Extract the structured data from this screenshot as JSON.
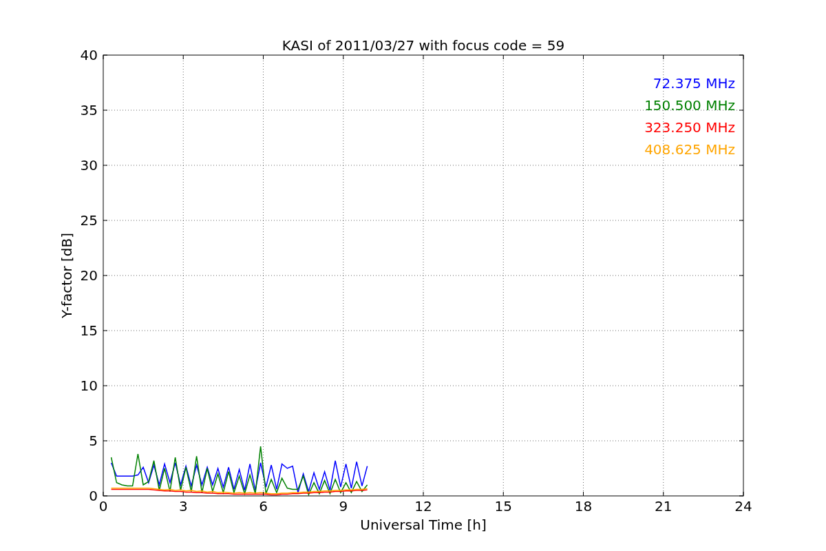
{
  "chart_data": {
    "type": "line",
    "title": "KASI of 2011/03/27 with focus code = 59",
    "xlabel": "Universal Time [h]",
    "ylabel": "Y-factor [dB]",
    "x": [
      0.3,
      0.5,
      0.7,
      0.9,
      1.1,
      1.3,
      1.5,
      1.7,
      1.9,
      2.1,
      2.3,
      2.5,
      2.7,
      2.9,
      3.1,
      3.3,
      3.5,
      3.7,
      3.9,
      4.1,
      4.3,
      4.5,
      4.7,
      4.9,
      5.1,
      5.3,
      5.5,
      5.7,
      5.9,
      6.1,
      6.3,
      6.5,
      6.7,
      6.9,
      7.1,
      7.3,
      7.5,
      7.7,
      7.9,
      8.1,
      8.3,
      8.5,
      8.7,
      8.9,
      9.1,
      9.3,
      9.5,
      9.7,
      9.9
    ],
    "series": [
      {
        "name": "72.375 MHz",
        "color": "#0000ff",
        "values": [
          3.0,
          1.8,
          1.8,
          1.8,
          1.8,
          1.9,
          2.6,
          1.2,
          2.8,
          1.0,
          2.9,
          1.2,
          3.0,
          1.0,
          2.7,
          0.9,
          2.8,
          1.0,
          2.6,
          1.0,
          2.5,
          0.8,
          2.6,
          0.6,
          2.4,
          0.5,
          2.9,
          0.5,
          3.0,
          0.8,
          2.8,
          0.6,
          2.9,
          2.5,
          2.7,
          0.3,
          2.0,
          0.4,
          2.1,
          0.6,
          2.2,
          0.5,
          3.2,
          0.8,
          2.9,
          0.7,
          3.1,
          0.9,
          2.7
        ]
      },
      {
        "name": "150.500 MHz",
        "color": "#008000",
        "values": [
          3.5,
          1.2,
          1.0,
          0.9,
          0.9,
          3.8,
          1.0,
          1.3,
          3.2,
          0.5,
          2.5,
          0.4,
          3.5,
          0.5,
          2.6,
          0.4,
          3.6,
          0.3,
          2.5,
          0.4,
          2.0,
          0.3,
          2.2,
          0.3,
          1.8,
          0.2,
          1.9,
          0.2,
          4.5,
          0.2,
          1.5,
          0.3,
          1.6,
          0.7,
          0.6,
          0.6,
          1.8,
          0.1,
          1.2,
          0.2,
          1.4,
          0.2,
          1.5,
          0.3,
          1.2,
          0.3,
          1.3,
          0.4,
          1.0
        ]
      },
      {
        "name": "323.250 MHz",
        "color": "#ff0000",
        "values": [
          0.6,
          0.6,
          0.6,
          0.6,
          0.6,
          0.6,
          0.6,
          0.6,
          0.55,
          0.5,
          0.45,
          0.45,
          0.4,
          0.4,
          0.35,
          0.35,
          0.3,
          0.3,
          0.25,
          0.25,
          0.2,
          0.2,
          0.2,
          0.15,
          0.15,
          0.15,
          0.15,
          0.15,
          0.15,
          0.15,
          0.1,
          0.1,
          0.15,
          0.15,
          0.2,
          0.2,
          0.25,
          0.25,
          0.3,
          0.3,
          0.35,
          0.35,
          0.4,
          0.4,
          0.45,
          0.45,
          0.5,
          0.5,
          0.55
        ]
      },
      {
        "name": "408.625 MHz",
        "color": "#ffa500",
        "values": [
          0.7,
          0.7,
          0.7,
          0.7,
          0.7,
          0.7,
          0.7,
          0.7,
          0.65,
          0.6,
          0.55,
          0.6,
          0.5,
          0.55,
          0.45,
          0.5,
          0.4,
          0.45,
          0.35,
          0.4,
          0.3,
          0.35,
          0.3,
          0.25,
          0.3,
          0.25,
          0.3,
          0.25,
          0.3,
          0.25,
          0.2,
          0.2,
          0.25,
          0.25,
          0.3,
          0.3,
          0.35,
          0.35,
          0.4,
          0.4,
          0.45,
          0.45,
          0.5,
          0.5,
          0.55,
          0.55,
          0.6,
          0.6,
          0.65
        ]
      }
    ],
    "xlim": [
      0,
      24
    ],
    "ylim": [
      0,
      40
    ],
    "xticks": [
      0,
      3,
      6,
      9,
      12,
      15,
      18,
      21,
      24
    ],
    "yticks": [
      0,
      5,
      10,
      15,
      20,
      25,
      30,
      35,
      40
    ],
    "grid": true
  }
}
